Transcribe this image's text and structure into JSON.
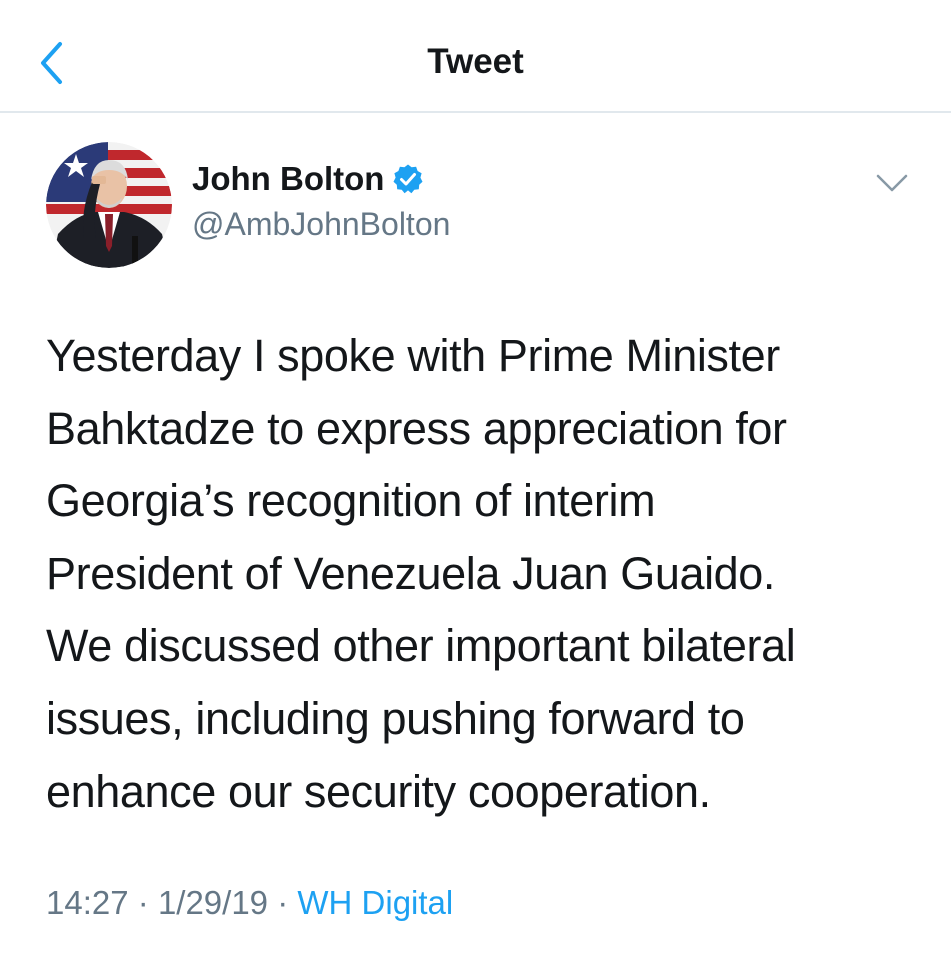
{
  "header": {
    "title": "Tweet",
    "back_icon": "chevron-left-icon"
  },
  "author": {
    "name": "John Bolton",
    "handle": "@AmbJohnBolton",
    "verified_icon": "verified-badge-icon",
    "more_icon": "chevron-down-icon"
  },
  "tweet": {
    "lines": [
      "Yesterday I spoke with Prime Minister",
      "Bahktadze to express appreciation for",
      "Georgia’s recognition of interim",
      "President of Venezuela Juan Guaido.",
      "We discussed other important bilateral",
      "issues, including pushing forward to",
      "enhance our security cooperation."
    ],
    "time": "14:27",
    "date": "1/29/19",
    "separator": "·",
    "source": "WH Digital"
  },
  "colors": {
    "accent": "#1da1f2",
    "text": "#14171a",
    "muted": "#657786",
    "divider": "#e1e8ed"
  }
}
